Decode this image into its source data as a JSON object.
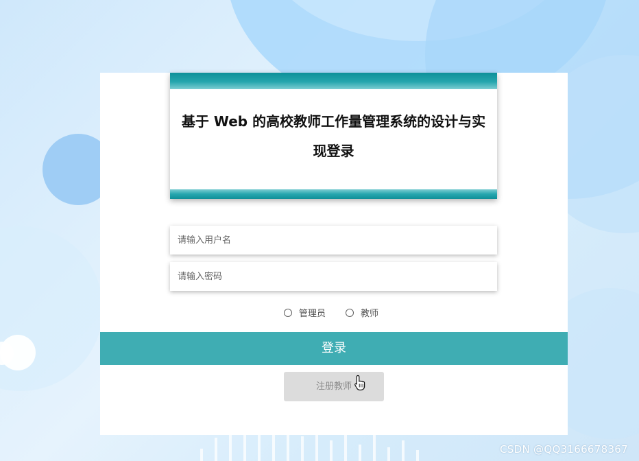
{
  "login": {
    "title": "基于 Web 的高校教师工作量管理系统的设计与实现登录",
    "username_placeholder": "请输入用户名",
    "password_placeholder": "请输入密码",
    "roles": [
      "管理员",
      "教师"
    ],
    "login_label": "登录",
    "register_label": "注册教师"
  },
  "watermark": "CSDN @QQ3166678367",
  "colors": {
    "accent": "#3fadb3",
    "header_strip": "#1a9aa3",
    "register_bg": "#dcdcdc"
  },
  "icons": {
    "cursor": "hand-pointer-cursor"
  }
}
